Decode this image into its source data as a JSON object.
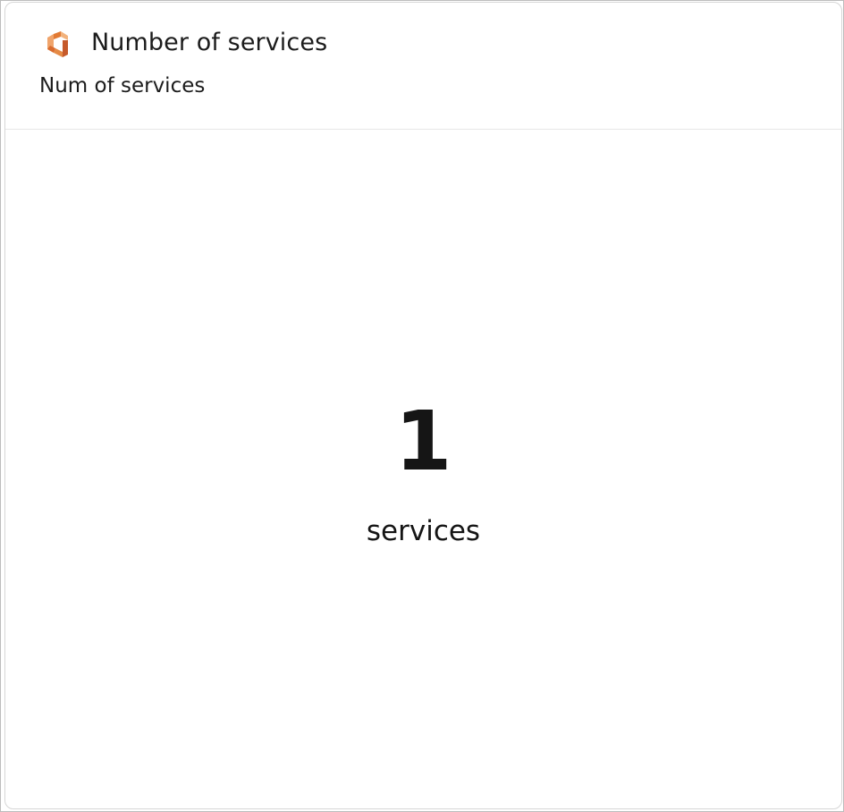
{
  "widget": {
    "logo_icon": "hexagon-logo-icon",
    "title": "Number of services",
    "subtitle": "Num of services",
    "metric": {
      "value": "1",
      "unit": "services"
    },
    "colors": {
      "logo_orange": "#e8833a",
      "logo_dark": "#c1542a"
    }
  }
}
